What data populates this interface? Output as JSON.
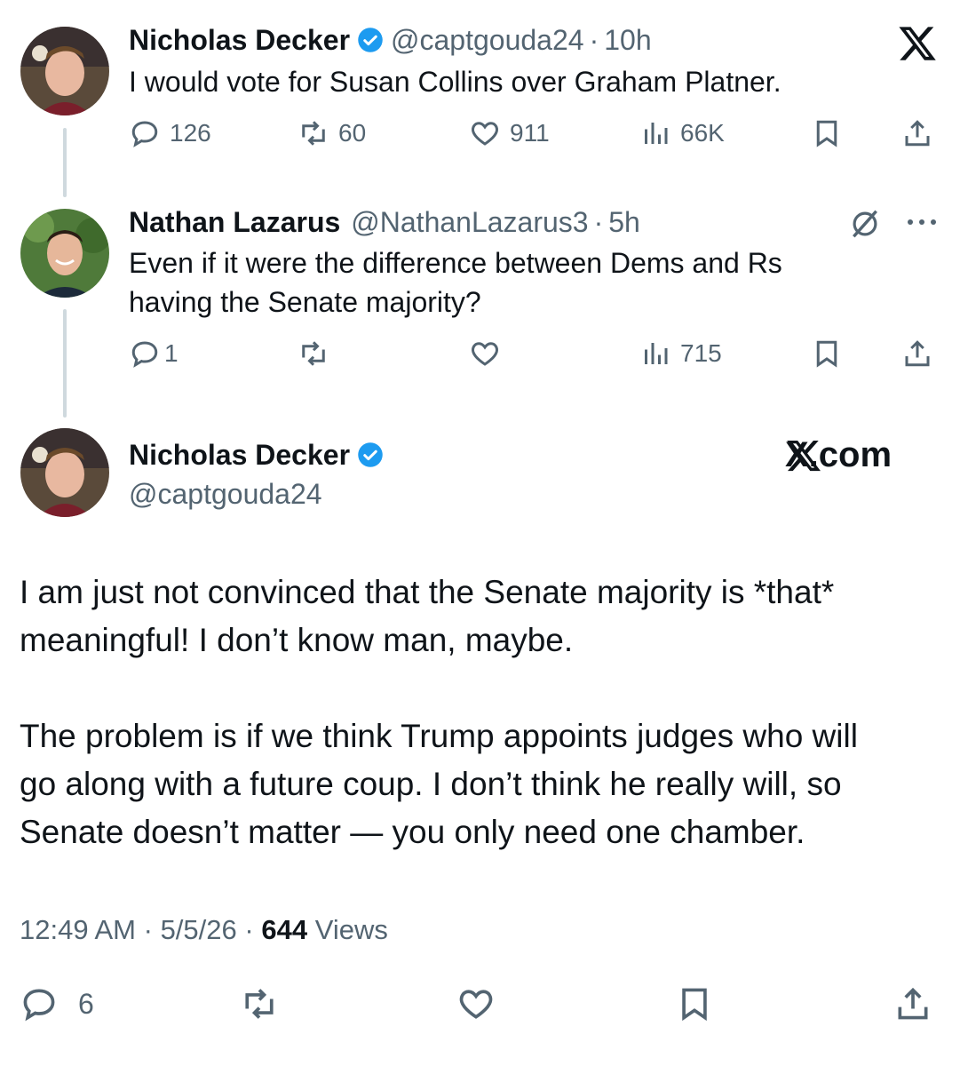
{
  "tweet1": {
    "name": "Nicholas Decker",
    "handle": "@captgouda24",
    "dot": "·",
    "time": "10h",
    "text": "I would vote for Susan Collins over Graham Platner.",
    "replies": "126",
    "reposts": "60",
    "likes": "911",
    "views": "66K"
  },
  "tweet2": {
    "name": "Nathan Lazarus",
    "handle": "@NathanLazarus3",
    "dot": "·",
    "time": "5h",
    "text_line1": "Even if it were the difference between Dems and Rs",
    "text_line2": "having the Senate majority?",
    "replies": "1",
    "views": "715"
  },
  "main": {
    "name": "Nicholas Decker",
    "handle": "@captgouda24",
    "brand": "X.com",
    "para1_line1": "I am just not convinced that the Senate majority is *that*",
    "para1_line2": "meaningful! I don’t know man, maybe.",
    "para2_line1": "The problem is if we think Trump appoints judges who will",
    "para2_line2": "go along with a future coup. I don’t think he really will, so",
    "para2_line3": "Senate doesn’t matter — you only need one chamber.",
    "time": "12:49 AM",
    "date": "5/5/26",
    "views_count": "644",
    "views_label": "Views",
    "sep": "·",
    "replies": "6"
  },
  "icons": {
    "corner": "x-logo-icon",
    "verified": "verified-badge-icon",
    "reply": "reply-icon",
    "repost": "repost-icon",
    "like": "heart-icon",
    "views": "views-bar-chart-icon",
    "bookmark": "bookmark-icon",
    "share": "share-icon",
    "grok": "grok-icon",
    "more": "more-dots-icon"
  },
  "colors": {
    "verified": "#1d9bf0",
    "muted": "#536471",
    "text": "#0f1419",
    "thread": "#cfd9de"
  }
}
